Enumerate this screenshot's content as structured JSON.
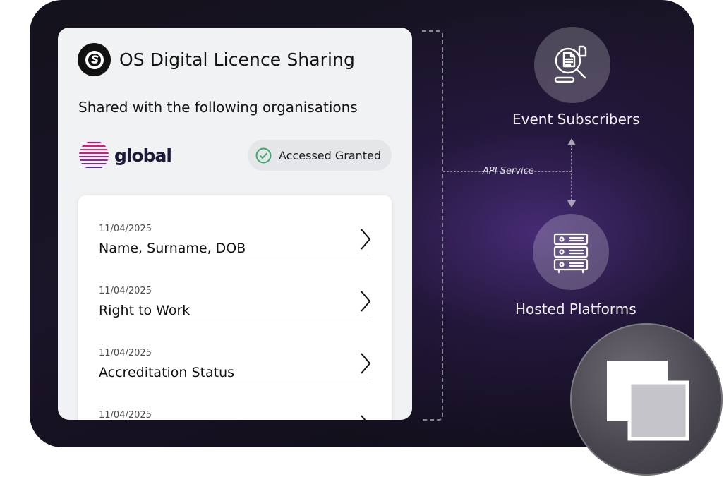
{
  "card": {
    "title": "OS Digital Licence Sharing",
    "subtitle": "Shared with the following organisations",
    "org_name": "global",
    "access_status": "Accessed Granted"
  },
  "items": [
    {
      "date": "11/04/2025",
      "title": "Name, Surname, DOB"
    },
    {
      "date": "11/04/2025",
      "title": "Right to Work"
    },
    {
      "date": "11/04/2025",
      "title": "Accreditation Status"
    },
    {
      "date": "11/04/2025",
      "title": ""
    }
  ],
  "diagram": {
    "api_label": "API Service",
    "event_subscribers": "Event Subscribers",
    "hosted_platforms": "Hosted Platforms"
  },
  "colors": {
    "accent_green": "#3dab6a",
    "org_brand_pink": "#e6007e",
    "card_bg": "#f1f2f4",
    "stage_bg": "#14121c"
  },
  "icons": {
    "brand": "os-logo-icon",
    "org": "global-logo-icon",
    "access": "check-circle-icon",
    "chevron": "chevron-right-icon",
    "event": "document-search-icon",
    "hosted": "server-rack-icon",
    "badge": "overlapping-squares-icon"
  }
}
